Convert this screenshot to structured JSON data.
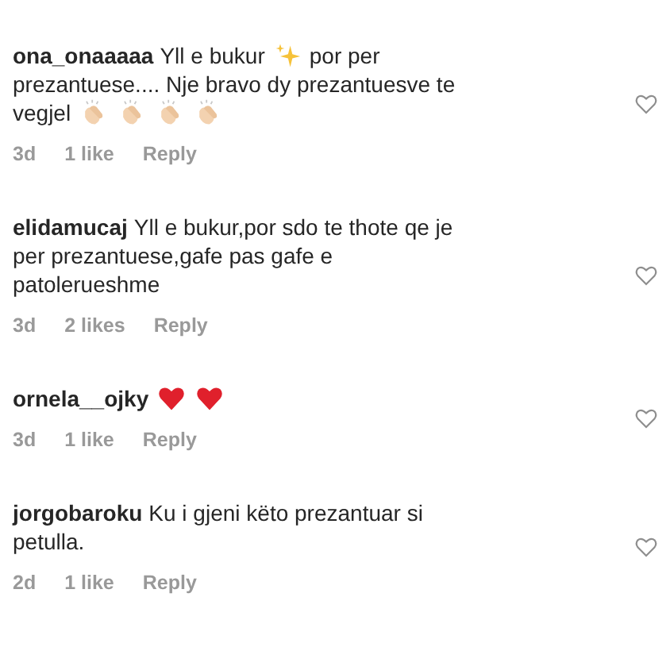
{
  "comments": [
    {
      "username": "ona_onaaaaa",
      "liked": false,
      "lines": [
        [
          {
            "kind": "text",
            "text": "Yll e bukur"
          },
          {
            "kind": "sparkles"
          },
          {
            "kind": "text",
            "text": "por per"
          }
        ],
        [
          {
            "kind": "text",
            "text": "prezantuese.... Nje bravo dy prezantuesve te"
          }
        ],
        [
          {
            "kind": "text",
            "text": "vegjel"
          },
          {
            "kind": "clap"
          },
          {
            "kind": "clap"
          },
          {
            "kind": "clap"
          },
          {
            "kind": "clap"
          }
        ]
      ],
      "time": "3d",
      "likes": "1 like",
      "reply": "Reply"
    },
    {
      "username": "elidamucaj",
      "liked": false,
      "lines": [
        [
          {
            "kind": "text",
            "text": "Yll e bukur,por sdo te thote qe je"
          }
        ],
        [
          {
            "kind": "text",
            "text": "per prezantuese,gafe pas gafe e"
          }
        ],
        [
          {
            "kind": "text",
            "text": "patolerueshme"
          }
        ]
      ],
      "time": "3d",
      "likes": "2 likes",
      "reply": "Reply"
    },
    {
      "username": "ornela__ojky",
      "liked": false,
      "lines": [
        [
          {
            "kind": "heart"
          },
          {
            "kind": "heart"
          }
        ]
      ],
      "time": "3d",
      "likes": "1 like",
      "reply": "Reply"
    },
    {
      "username": "jorgobaroku",
      "liked": false,
      "lines": [
        [
          {
            "kind": "text",
            "text": "Ku i gjeni këto prezantuar si"
          }
        ],
        [
          {
            "kind": "text",
            "text": "petulla."
          }
        ]
      ],
      "time": "2d",
      "likes": "1 like",
      "reply": "Reply"
    }
  ]
}
